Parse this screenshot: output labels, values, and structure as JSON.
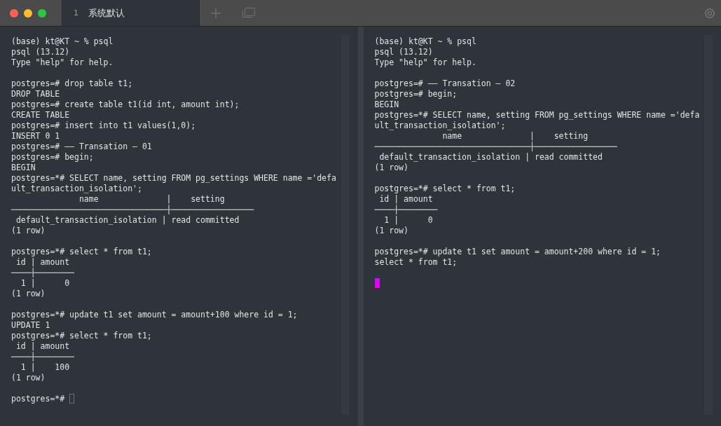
{
  "tabs": [
    {
      "number": "1",
      "label": "系统默认",
      "selected": true
    }
  ],
  "panes": [
    {
      "focused": false,
      "prompt": "postgres=*# ",
      "blocks": [
        [
          "(base) kt@KT ~ % psql",
          "psql (13.12)",
          "Type \"help\" for help."
        ],
        [
          "postgres=# drop table t1;",
          "DROP TABLE",
          "postgres=# create table t1(id int, amount int);",
          "CREATE TABLE",
          "postgres=# insert into t1 values(1,0);",
          "INSERT 0 1",
          "postgres=# —— Transation — 01",
          "postgres=# begin;",
          "BEGIN",
          "postgres=*# SELECT name, setting FROM pg_settings WHERE name ='defa",
          "ult_transaction_isolation';",
          "              name              |    setting",
          "────────────────────────────────┼─────────────────",
          " default_transaction_isolation | read committed",
          "(1 row)"
        ],
        [
          "postgres=*# select * from t1;",
          " id | amount",
          "────┼────────",
          "  1 |      0",
          "(1 row)"
        ],
        [
          "postgres=*# update t1 set amount = amount+100 where id = 1;",
          "UPDATE 1",
          "postgres=*# select * from t1;",
          " id | amount",
          "────┼────────",
          "  1 |    100",
          "(1 row)"
        ]
      ]
    },
    {
      "focused": true,
      "blocks": [
        [
          "(base) kt@KT ~ % psql",
          "psql (13.12)",
          "Type \"help\" for help."
        ],
        [
          "postgres=# —— Transation — 02",
          "postgres=# begin;",
          "BEGIN",
          "postgres=*# SELECT name, setting FROM pg_settings WHERE name ='defa",
          "ult_transaction_isolation';",
          "              name              |    setting",
          "────────────────────────────────┼─────────────────",
          " default_transaction_isolation | read committed",
          "(1 row)"
        ],
        [
          "postgres=*# select * from t1;",
          " id | amount",
          "────┼────────",
          "  1 |      0",
          "(1 row)"
        ],
        [
          "postgres=*# update t1 set amount = amount+200 where id = 1;",
          "select * from t1;"
        ]
      ]
    }
  ]
}
